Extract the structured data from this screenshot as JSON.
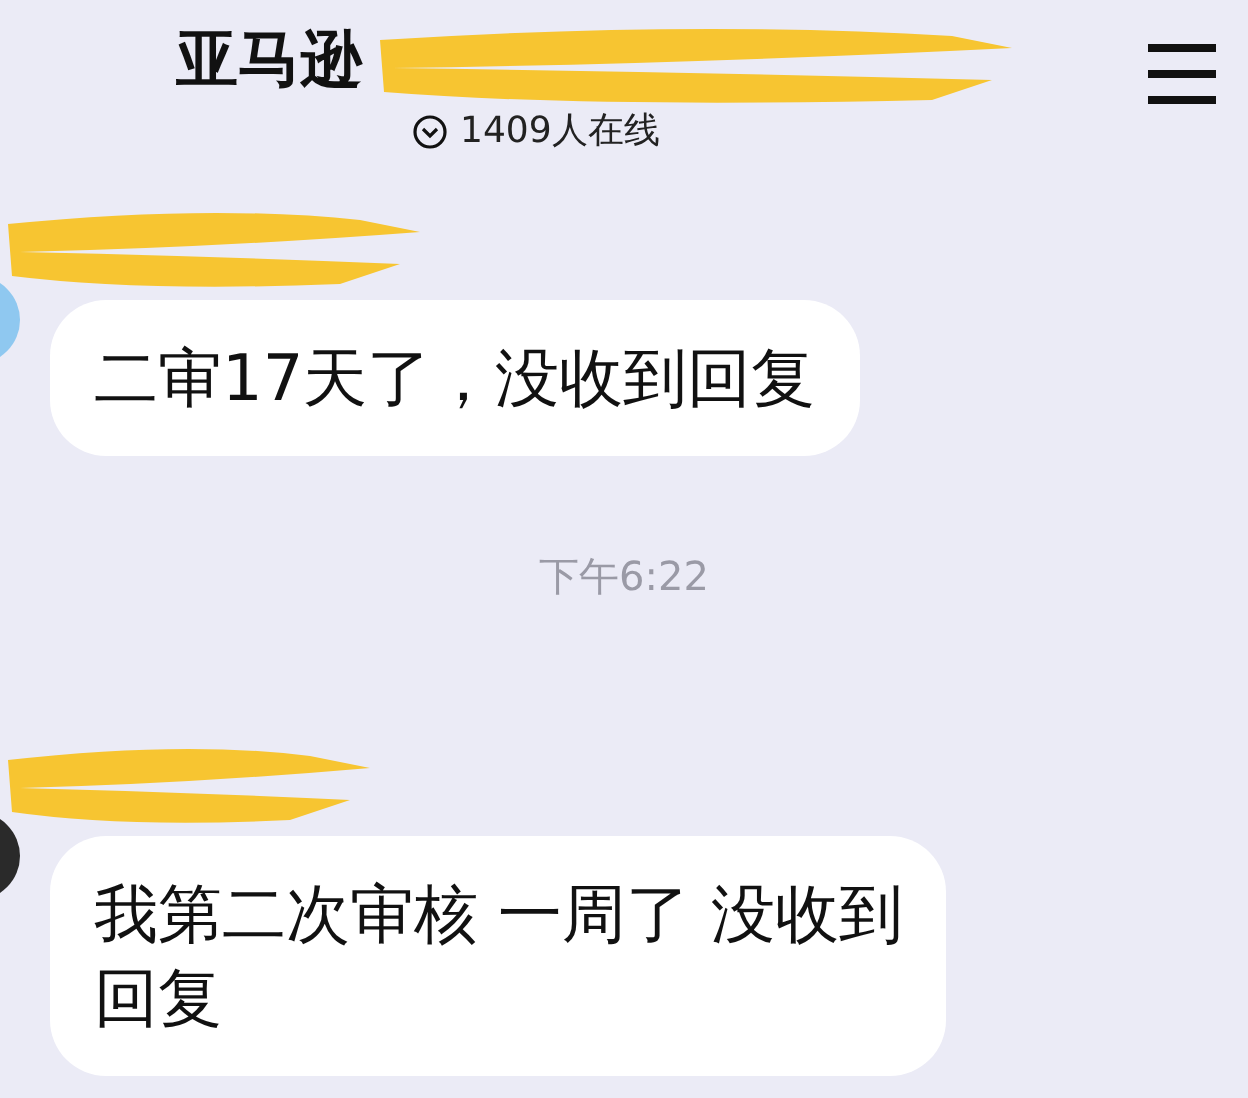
{
  "header": {
    "title": "亚马逊",
    "online": "1409人在线"
  },
  "messages": [
    {
      "kind": "message",
      "color": "#8fc8f0",
      "lines": [
        "二审17天了，没收到回复"
      ]
    },
    {
      "kind": "time",
      "text": "下午6:22"
    },
    {
      "kind": "message",
      "color": "#2a2a2a",
      "lines": [
        "我第二次审核 一周了 没收到",
        "回复"
      ]
    }
  ]
}
